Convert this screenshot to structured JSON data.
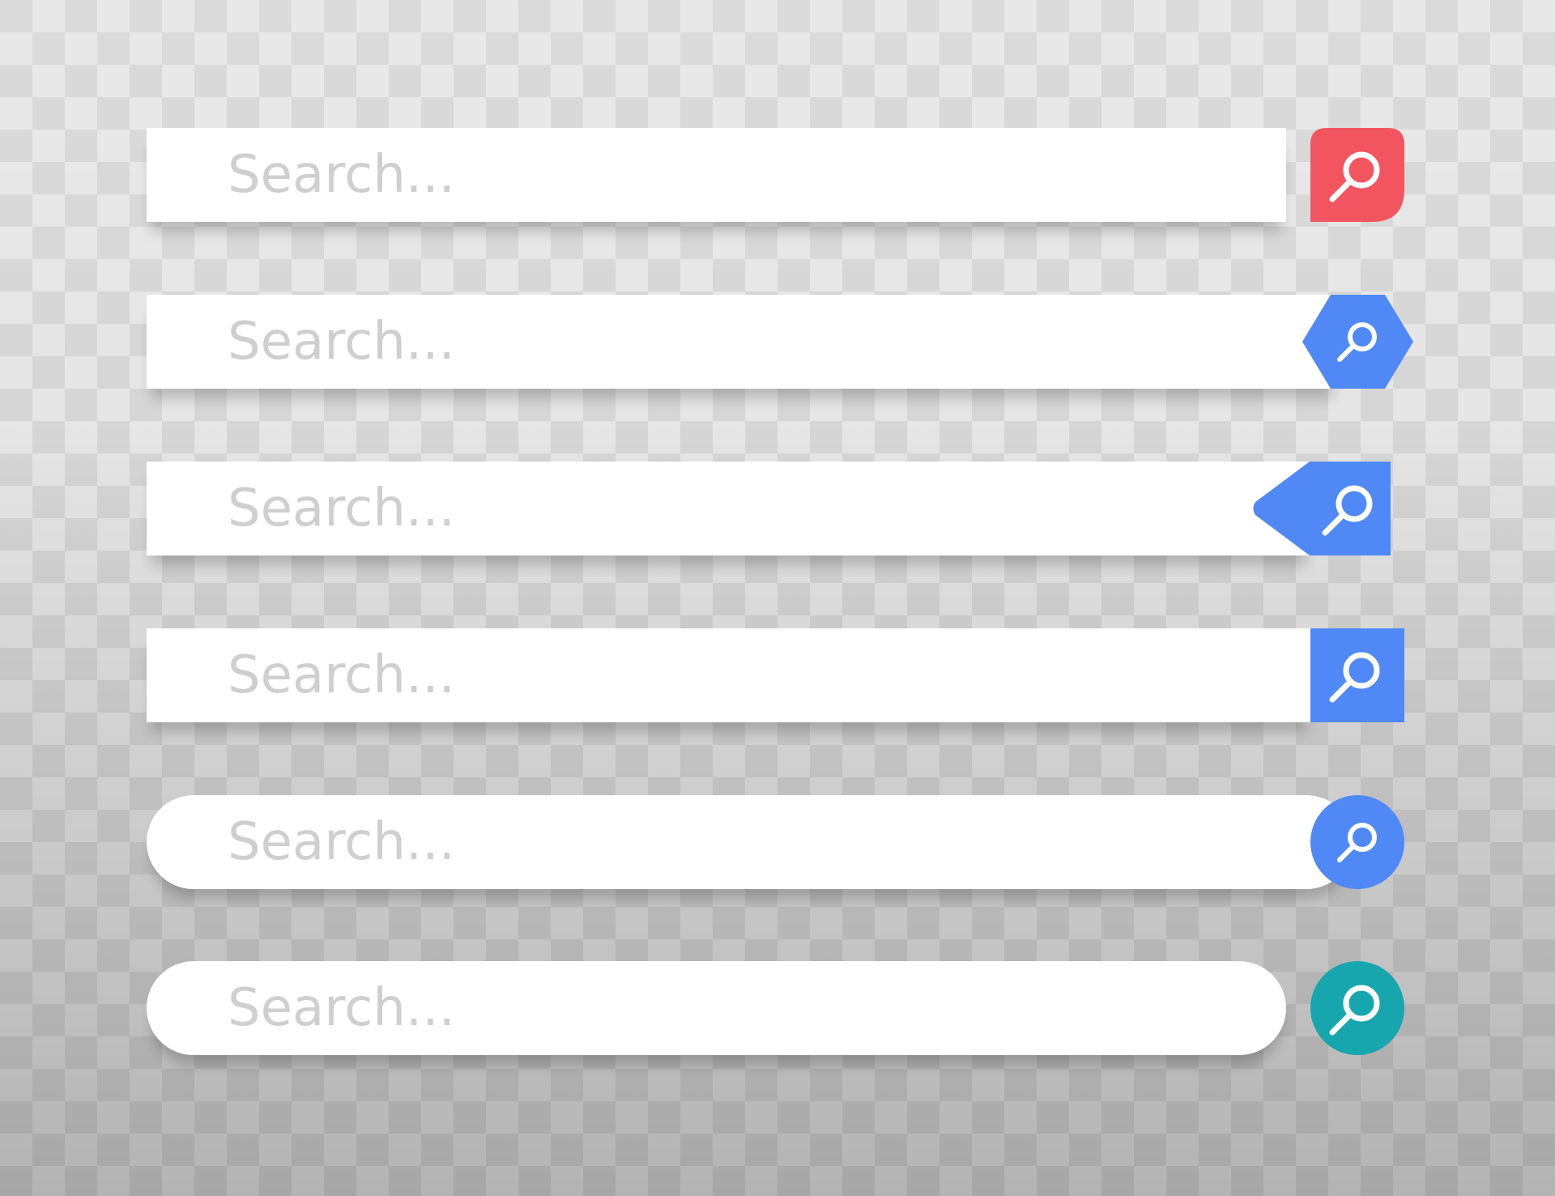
{
  "search_bars": [
    {
      "placeholder": "Search...",
      "button_color": "#f35560",
      "button_shape": "rounded-tab",
      "icon": "search-icon"
    },
    {
      "placeholder": "Search...",
      "button_color": "#5089f6",
      "button_shape": "hexagon",
      "icon": "search-icon"
    },
    {
      "placeholder": "Search...",
      "button_color": "#5089f6",
      "button_shape": "arrow-tab",
      "icon": "search-icon"
    },
    {
      "placeholder": "Search...",
      "button_color": "#5089f6",
      "button_shape": "square",
      "icon": "search-icon"
    },
    {
      "placeholder": "Search...",
      "button_color": "#5089f6",
      "button_shape": "circle",
      "icon": "search-icon"
    },
    {
      "placeholder": "Search...",
      "button_color": "#17a6ae",
      "button_shape": "circle",
      "icon": "search-icon"
    }
  ]
}
